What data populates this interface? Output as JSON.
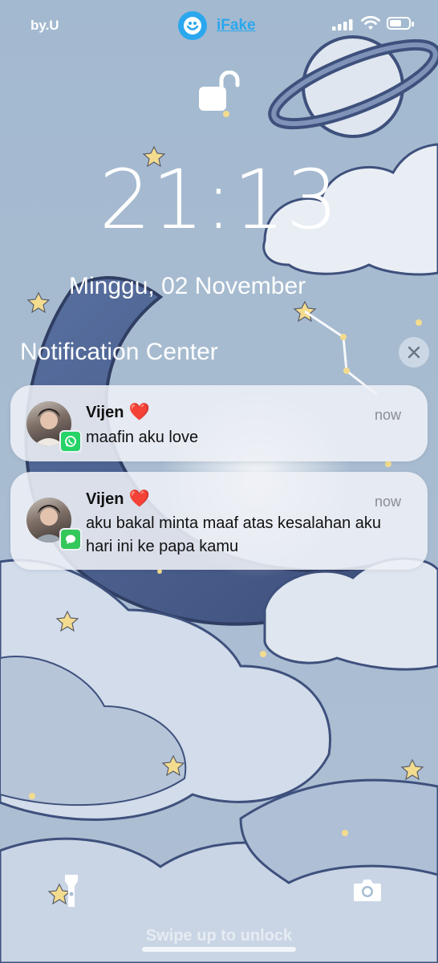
{
  "status_bar": {
    "carrier": "by.U",
    "app_name": "iFake"
  },
  "lockscreen": {
    "time": "21:13",
    "date": "Minggu, 02 November",
    "notification_center_title": "Notification Center",
    "swipe_hint": "Swipe up to unlock"
  },
  "notifications": [
    {
      "sender": "Vijen",
      "emoji": "❤️",
      "time": "now",
      "message": "maafin aku love",
      "app_icon": "whatsapp-icon",
      "app_color": "#25d366"
    },
    {
      "sender": "Vijen",
      "emoji": "❤️",
      "time": "now",
      "message": "aku bakal minta maaf atas kesalahan aku hari ini ke papa kamu",
      "app_icon": "messages-icon",
      "app_color": "#34c759"
    }
  ],
  "colors": {
    "wallpaper": "#a9bed3",
    "moon": "#4a5f8e",
    "accent": "#2aa7ee"
  }
}
